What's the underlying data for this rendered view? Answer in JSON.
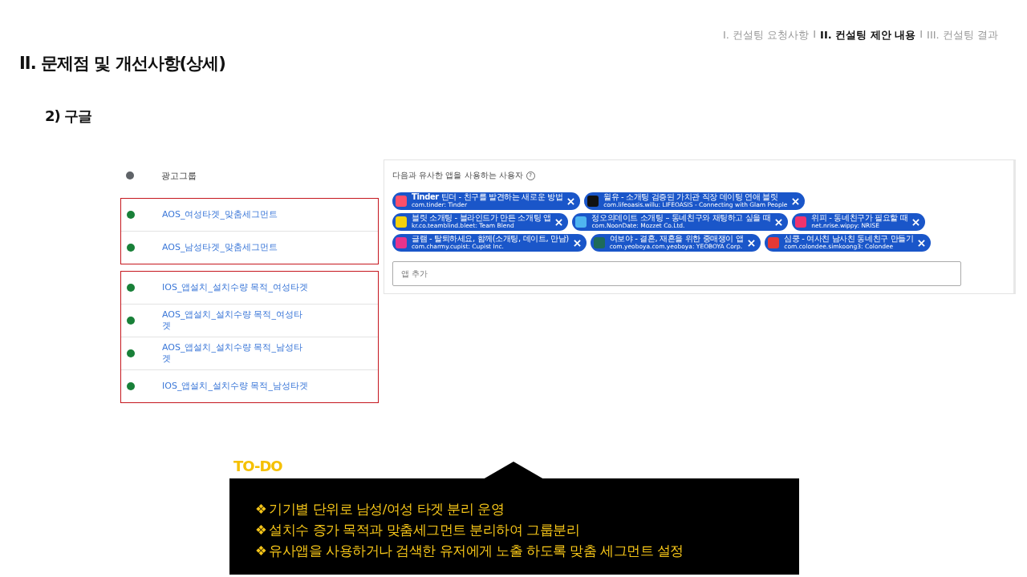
{
  "breadcrumb": {
    "separators": [
      "I",
      "I"
    ],
    "items": [
      {
        "label": "I. 컨설팅 요청사항",
        "selected": false
      },
      {
        "label": "II. 컨설팅 제안 내용",
        "selected": true
      },
      {
        "label": "III. 컨설팅 결과",
        "selected": false
      }
    ]
  },
  "title": "II. 문제점 및 개선사항(상세)",
  "subtitle": "2) 구글",
  "ad_groups": {
    "header": {
      "label": "광고그룹",
      "color": "#5f6368"
    },
    "groups": [
      {
        "rows": [
          {
            "name": "AOS_여성타겟_맞춤세그먼트",
            "color": "#188038"
          },
          {
            "name": "AOS_남성타겟_맞춤세그먼트",
            "color": "#188038"
          }
        ]
      },
      {
        "rows": [
          {
            "name": "IOS_앱설치_설치수량 목적_여성타겟",
            "color": "#188038"
          },
          {
            "name": "AOS_앱설치_설치수량 목적_여성타겟",
            "color": "#188038"
          },
          {
            "name": "AOS_앱설치_설치수량 목적_남성타겟",
            "color": "#188038"
          },
          {
            "name": "IOS_앱설치_설치수량 목적_남성타겟",
            "color": "#188038"
          }
        ]
      }
    ]
  },
  "similar_apps": {
    "label": "다음과 유사한 앱을 사용하는 사용자",
    "help": "?",
    "chip_rows": [
      [
        {
          "title": "**Tinder** 틴더 - 친구를 발견하는 새로운 방법",
          "package": "com.tinder: Tinder",
          "color": "#fd4f6a"
        },
        {
          "title": "윌유 - 소개팅 검증된 가치관 직장 데이팅 연애 블릿",
          "package": "com.lifeoasis.willu: LIFEOASIS - Connecting with Glam People",
          "color": "#111111"
        }
      ],
      [
        {
          "title": "블릿 소개팅 - 블라인드가 만든 소개팅 앱",
          "package": "kr.co.teamblind.bleet: Team Blend",
          "color": "#f5d20c"
        },
        {
          "title": "정오의데이트 소개팅 – 동네친구와 채팅하고 싶을 때",
          "package": "com.NoonDate: Mozzet Co.Ltd.",
          "color": "#4fb5f0"
        },
        {
          "title": "위피 - 동네친구가 필요할 때",
          "package": "net.nrise.wippy: NRISE",
          "color": "#f0336d"
        }
      ],
      [
        {
          "title": "글램 - 탈퇴하세요, 함께(소개팅, 데이트, 만남)",
          "package": "com.charmy.cupist: Cupist Inc.",
          "color": "#e8348c"
        },
        {
          "title": "여보야 - 결혼, 재혼을 위한 중매쟁이 앱",
          "package": "com.yeoboya.com.yeoboya: YEOBOYA Corp.",
          "color": "#1e6b5a"
        },
        {
          "title": "심쿵 - 여사친 남사친 동네친구 만들기",
          "package": "com.colondee.simkoong3: Colondee",
          "color": "#e53935"
        }
      ]
    ],
    "add_field": {
      "placeholder": "앱 추가"
    }
  },
  "todo": {
    "heading": "TO-DO",
    "bullet": "❖",
    "items": [
      "기기별 단위로 남성/여성 타겟 분리 운영",
      "설치수 증가 목적과 맞춤세그먼트 분리하여 그룹분리",
      "유사앱을 사용하거나 검색한 유저에게 노출 하도록 맞춤 세그먼트 설정"
    ]
  }
}
